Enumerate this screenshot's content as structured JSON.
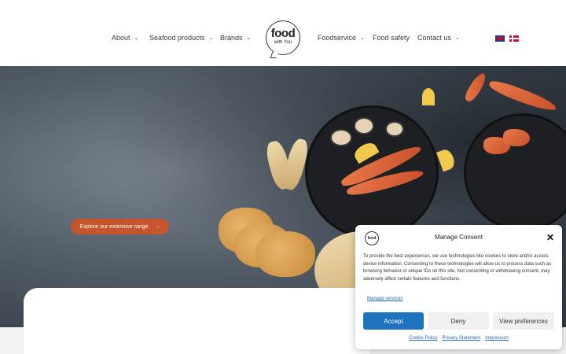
{
  "header": {
    "nav_left": [
      {
        "label": "About"
      },
      {
        "label": "Seafood products"
      },
      {
        "label": "Brands"
      }
    ],
    "nav_right": [
      {
        "label": "Foodservice"
      },
      {
        "label": "Food safety"
      },
      {
        "label": "Contact us"
      }
    ],
    "logo": {
      "line1": "food",
      "line2": "with You"
    },
    "languages": [
      "English",
      "Danish"
    ]
  },
  "hero": {
    "cta_label": "Explore our extensive range",
    "cta_icon": "→"
  },
  "consent": {
    "logo_text": "food",
    "title": "Manage Consent",
    "close_icon": "✕",
    "body": "To provide the best experiences, we use technologies like cookies to store and/or access device information. Consenting to these technologies will allow us to process data such as browsing behavior or unique IDs on this site. Not consenting or withdrawing consent, may adversely affect certain features and functions.",
    "manage_services": "Manage services",
    "accept": "Accept",
    "deny": "Deny",
    "view_preferences": "View preferences",
    "links": [
      "Cookie Policy",
      "Privacy Statement",
      "Impressum"
    ]
  },
  "colors": {
    "cta": "#c5552c",
    "accept": "#1e73be",
    "link": "#1e6bc4"
  }
}
